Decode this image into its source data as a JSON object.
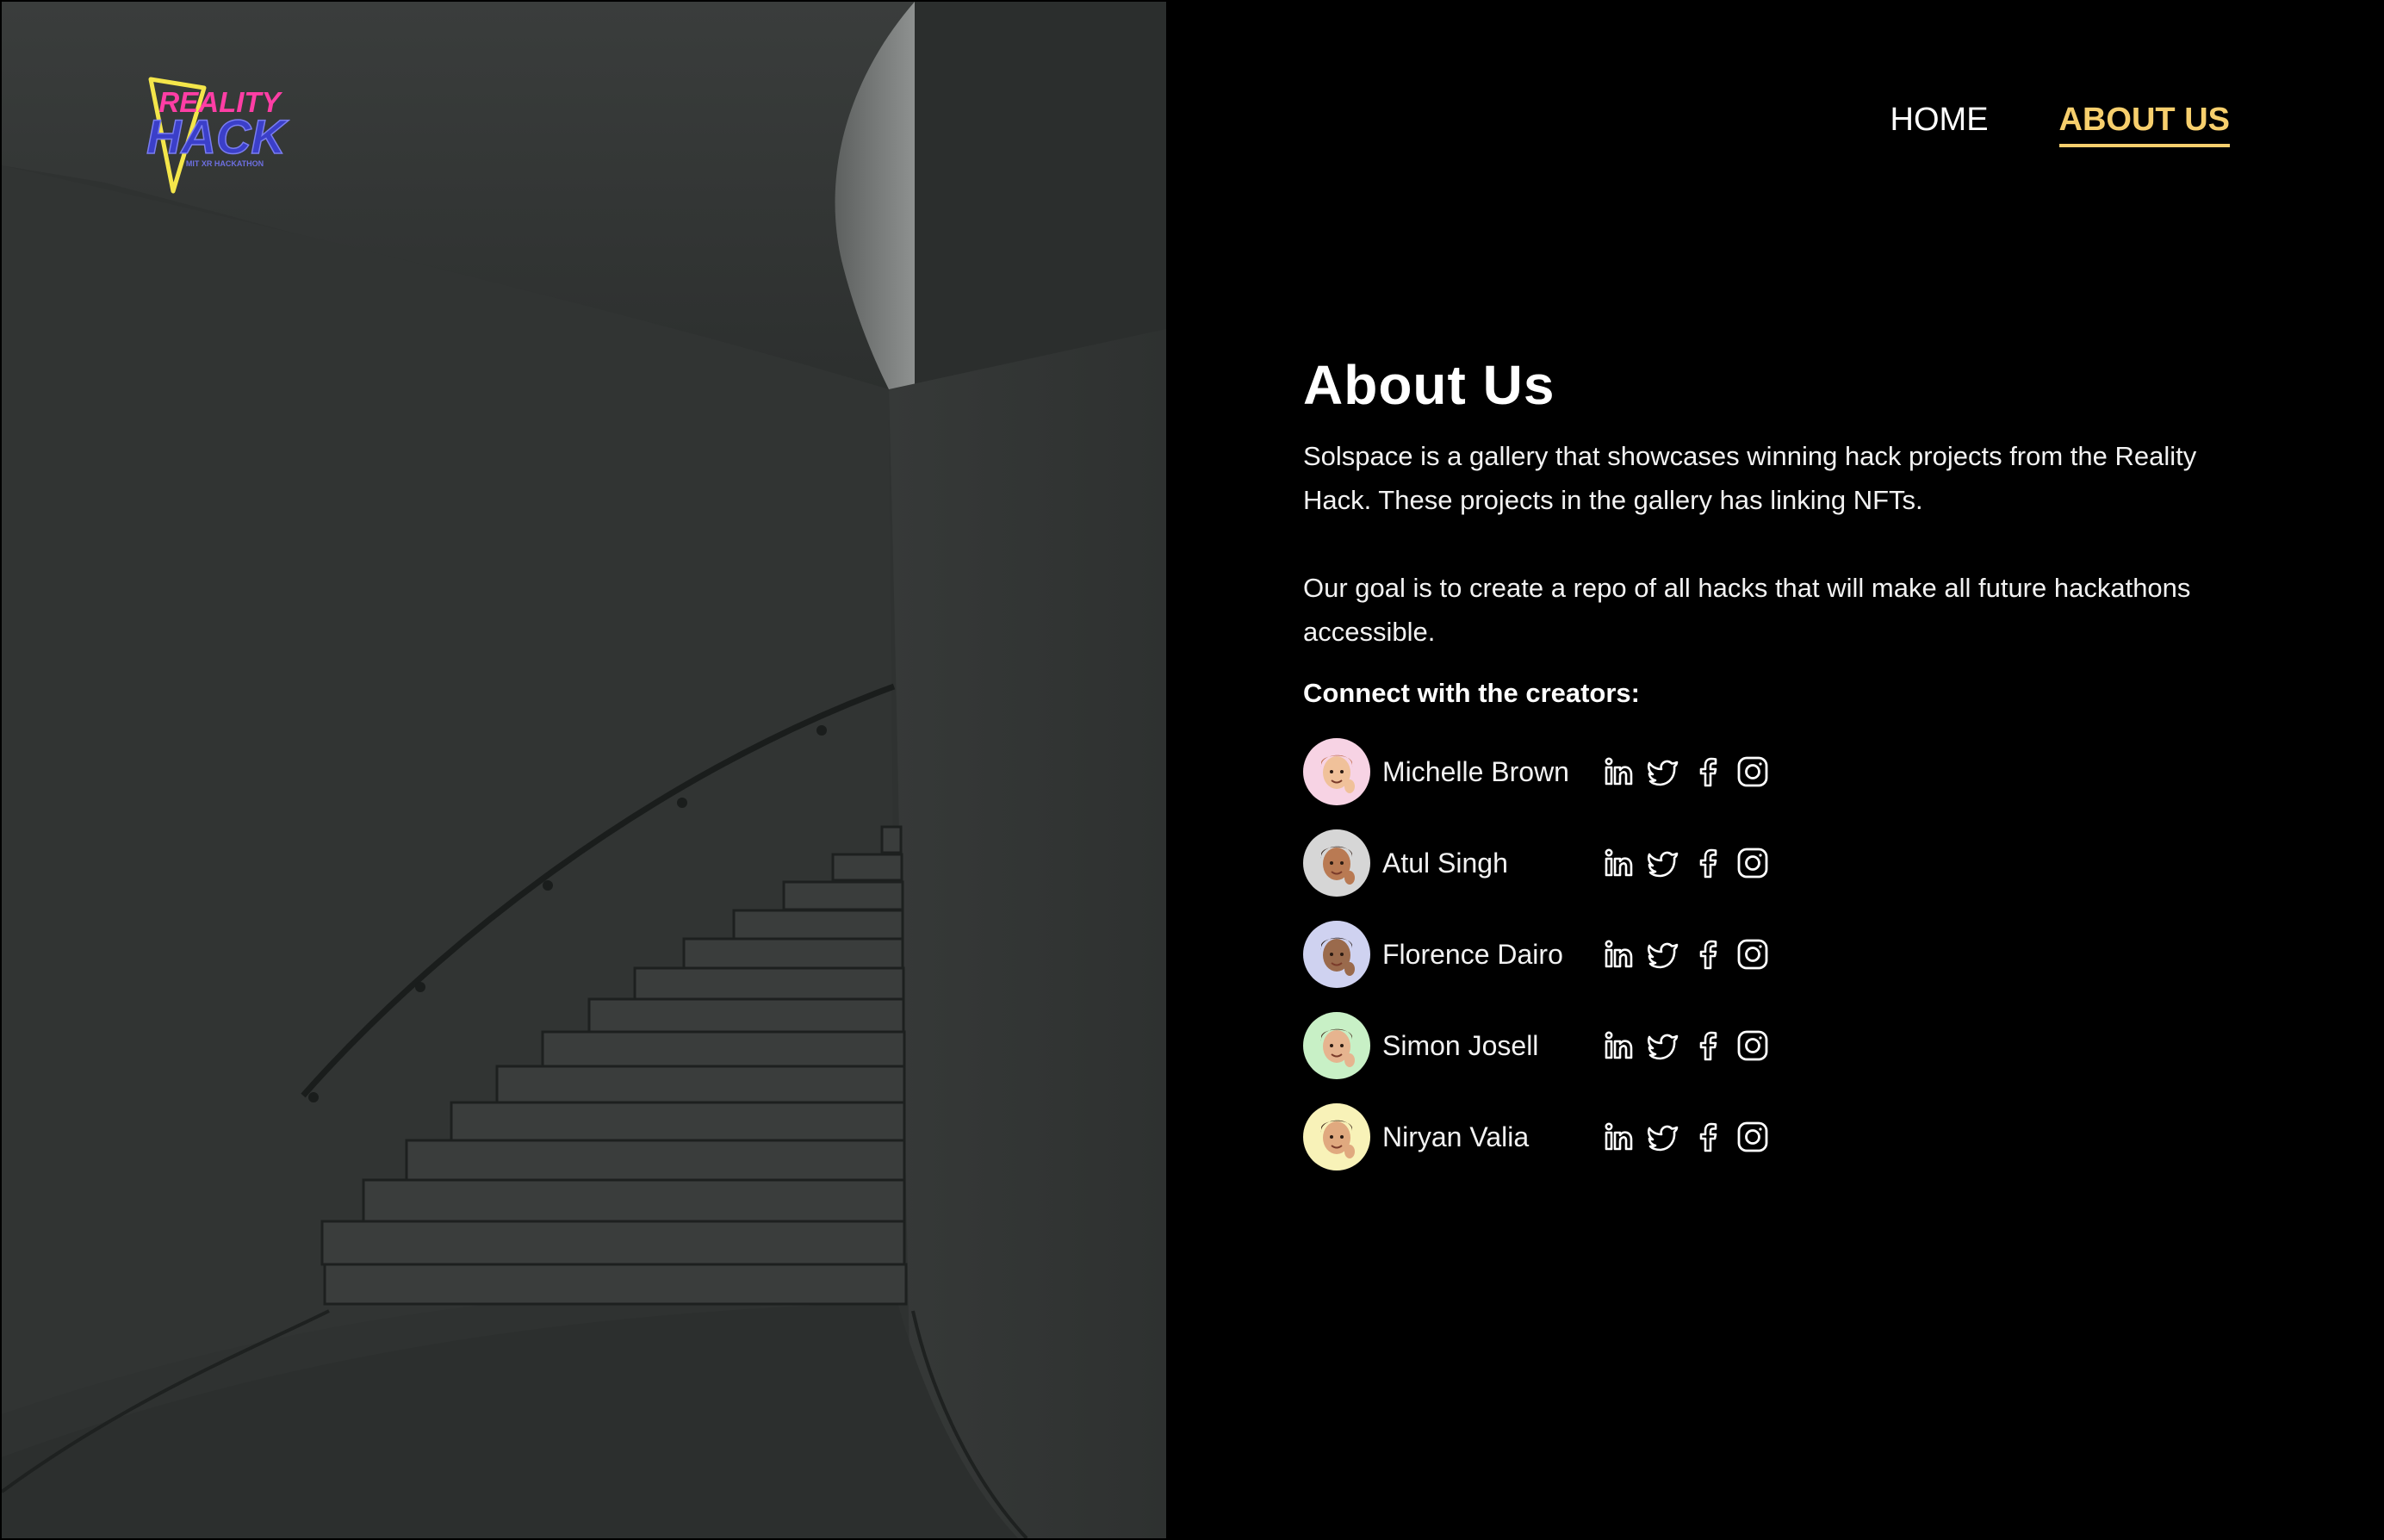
{
  "logo": {
    "line1": "REALITY",
    "line2": "HACK",
    "line3": "MIT XR HACKATHON"
  },
  "nav": {
    "home_label": "HOME",
    "about_label": "ABOUT US"
  },
  "about": {
    "title": "About Us",
    "paragraph_1": "Solspace is a gallery that showcases winning hack projects from the Reality Hack. These projects in the gallery has linking NFTs.",
    "paragraph_2": "Our goal is to create a repo of all hacks that will make all future hackathons accessible.",
    "connect_heading": "Connect with the creators:"
  },
  "creators": [
    {
      "name": "Michelle Brown",
      "avatar_bg": "#f7d3e4",
      "skin": "#f0c19a",
      "hair": "#c06d4c"
    },
    {
      "name": "Atul Singh",
      "avatar_bg": "#d6d6d6",
      "skin": "#b97a53",
      "hair": "#3b2a22"
    },
    {
      "name": "Florence Dairo",
      "avatar_bg": "#cfd2f0",
      "skin": "#9a6a4c",
      "hair": "#2a1d18"
    },
    {
      "name": "Simon Josell",
      "avatar_bg": "#c8f0c6",
      "skin": "#e6b48f",
      "hair": "#4a3123"
    },
    {
      "name": "Niryan Valia",
      "avatar_bg": "#f8f2b8",
      "skin": "#e0a97f",
      "hair": "#3a2418"
    }
  ],
  "social_icons": [
    "linkedin-icon",
    "twitter-icon",
    "facebook-icon",
    "instagram-icon"
  ],
  "colors": {
    "accent": "#f7cf6d",
    "background": "#000000",
    "text": "#ffffff",
    "logo_pink": "#ff3ea5",
    "logo_blue": "#3b3fc9",
    "logo_yellow": "#f4e64a"
  }
}
